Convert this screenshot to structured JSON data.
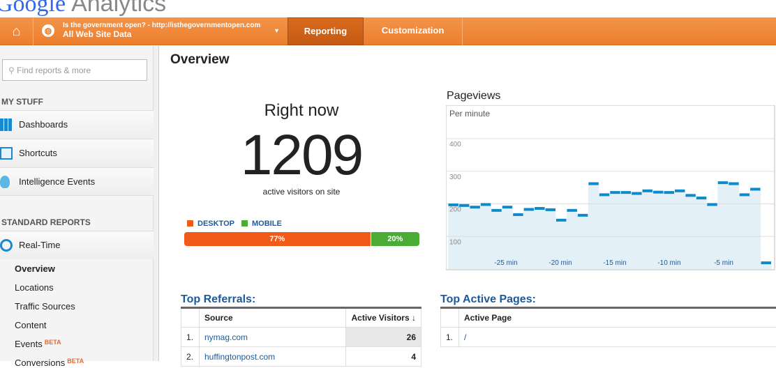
{
  "logo": {
    "brand": "Google",
    "product": "Analytics"
  },
  "topbar": {
    "site": "Is the government open? - http://isthegovernmentopen.com",
    "view": "All Web Site Data",
    "nav": [
      "Reporting",
      "Customization"
    ]
  },
  "sidebar": {
    "search_placeholder": "Find reports & more",
    "my_stuff": "MY STUFF",
    "my_items": [
      "Dashboards",
      "Shortcuts",
      "Intelligence Events"
    ],
    "standard": "STANDARD REPORTS",
    "realtime": "Real-Time",
    "sub_items": [
      {
        "label": "Overview",
        "active": true
      },
      {
        "label": "Locations"
      },
      {
        "label": "Traffic Sources"
      },
      {
        "label": "Content"
      },
      {
        "label": "Events",
        "badge": "BETA"
      },
      {
        "label": "Conversions",
        "badge": "BETA"
      }
    ]
  },
  "main": {
    "title": "Overview",
    "right_now": {
      "label": "Right now",
      "count": "1209",
      "sub": "active visitors on site"
    },
    "devices": [
      {
        "name": "DESKTOP",
        "pct": "77%",
        "value": 77,
        "color": "#f05a1a"
      },
      {
        "name": "MOBILE",
        "pct": "20%",
        "value": 20,
        "color": "#4aab35"
      }
    ],
    "referrals": {
      "title": "Top Referrals:",
      "headers": [
        "Source",
        "Active Visitors"
      ],
      "rows": [
        {
          "n": "1.",
          "source": "nymag.com",
          "visitors": "26"
        },
        {
          "n": "2.",
          "source": "huffingtonpost.com",
          "visitors": "4"
        }
      ]
    },
    "pages": {
      "title": "Top Active Pages:",
      "headers": [
        "Active Page"
      ],
      "rows": [
        {
          "n": "1.",
          "page": "/"
        }
      ]
    }
  },
  "chart_data": {
    "type": "bar",
    "title": "Pageviews",
    "subtitle": "Per minute",
    "y_ticks": [
      100,
      200,
      300,
      400
    ],
    "x_ticks": [
      "-25 min",
      "-20 min",
      "-15 min",
      "-10 min",
      "-5 min"
    ],
    "ylim": [
      0,
      400
    ],
    "color": "#0e8ac8",
    "fill": "#e3f0f7",
    "values": [
      197,
      195,
      190,
      198,
      180,
      190,
      167,
      183,
      186,
      182,
      150,
      180,
      165,
      262,
      228,
      235,
      235,
      232,
      240,
      236,
      235,
      240,
      226,
      218,
      198,
      265,
      262,
      228,
      245,
      19
    ]
  }
}
